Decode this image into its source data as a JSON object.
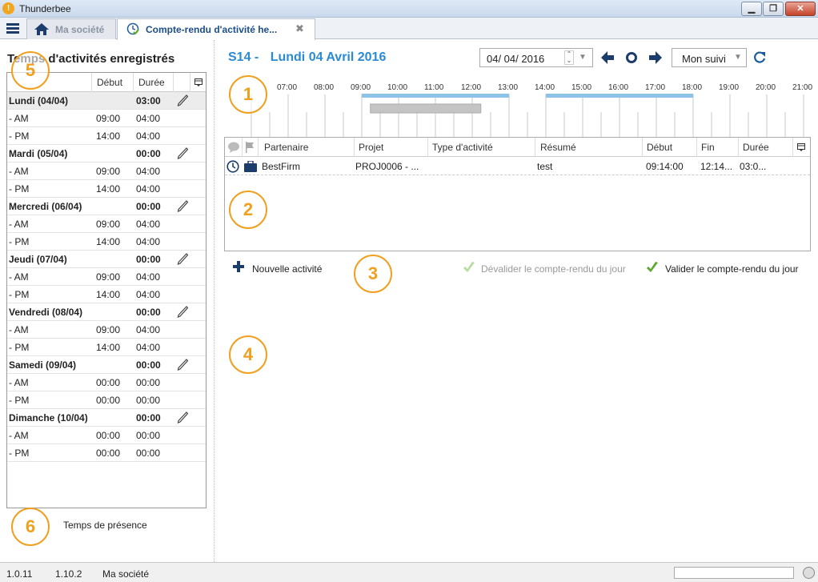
{
  "app": {
    "title": "Thunderbee"
  },
  "tabs": [
    {
      "label": "Ma société"
    },
    {
      "label": "Compte-rendu d'activité he..."
    }
  ],
  "left": {
    "title": "Temps d'activités enregistrés",
    "columns": [
      "",
      "Début",
      "Durée"
    ],
    "rows": [
      {
        "type": "day",
        "label": "Lundi (04/04)",
        "debut": "",
        "duree": "03:00"
      },
      {
        "type": "sub",
        "label": "- AM",
        "debut": "09:00",
        "duree": "04:00"
      },
      {
        "type": "sub",
        "label": "- PM",
        "debut": "14:00",
        "duree": "04:00"
      },
      {
        "type": "day",
        "label": "Mardi (05/04)",
        "debut": "",
        "duree": "00:00"
      },
      {
        "type": "sub",
        "label": "- AM",
        "debut": "09:00",
        "duree": "04:00"
      },
      {
        "type": "sub",
        "label": "- PM",
        "debut": "14:00",
        "duree": "04:00"
      },
      {
        "type": "day",
        "label": "Mercredi (06/04)",
        "debut": "",
        "duree": "00:00"
      },
      {
        "type": "sub",
        "label": "- AM",
        "debut": "09:00",
        "duree": "04:00"
      },
      {
        "type": "sub",
        "label": "- PM",
        "debut": "14:00",
        "duree": "04:00"
      },
      {
        "type": "day",
        "label": "Jeudi (07/04)",
        "debut": "",
        "duree": "00:00"
      },
      {
        "type": "sub",
        "label": "- AM",
        "debut": "09:00",
        "duree": "04:00"
      },
      {
        "type": "sub",
        "label": "- PM",
        "debut": "14:00",
        "duree": "04:00"
      },
      {
        "type": "day",
        "label": "Vendredi (08/04)",
        "debut": "",
        "duree": "00:00"
      },
      {
        "type": "sub",
        "label": "- AM",
        "debut": "09:00",
        "duree": "04:00"
      },
      {
        "type": "sub",
        "label": "- PM",
        "debut": "14:00",
        "duree": "04:00"
      },
      {
        "type": "day",
        "label": "Samedi (09/04)",
        "debut": "",
        "duree": "00:00"
      },
      {
        "type": "sub",
        "label": "- AM",
        "debut": "00:00",
        "duree": "00:00"
      },
      {
        "type": "sub",
        "label": "- PM",
        "debut": "00:00",
        "duree": "00:00"
      },
      {
        "type": "day",
        "label": "Dimanche (10/04)",
        "debut": "",
        "duree": "00:00"
      },
      {
        "type": "sub",
        "label": "- AM",
        "debut": "00:00",
        "duree": "00:00"
      },
      {
        "type": "sub",
        "label": "- PM",
        "debut": "00:00",
        "duree": "00:00"
      }
    ],
    "presence_label": "Temps de présence"
  },
  "header": {
    "week": "S14 -",
    "date_title": "Lundi 04 Avril 2016",
    "date_input": "04/ 04/  2016",
    "view_select": "Mon suivi"
  },
  "timeline": {
    "hours": [
      "07:00",
      "08:00",
      "09:00",
      "10:00",
      "11:00",
      "12:00",
      "13:00",
      "14:00",
      "15:00",
      "16:00",
      "17:00",
      "18:00",
      "19:00",
      "20:00",
      "21:00"
    ],
    "blue_ranges": [
      [
        "09:00",
        "13:00"
      ],
      [
        "14:00",
        "18:00"
      ]
    ],
    "activity_range": [
      "09:14",
      "12:14"
    ]
  },
  "grid": {
    "columns": [
      "Partenaire",
      "Projet",
      "Type d'activité",
      "Résumé",
      "Début",
      "Fin",
      "Durée"
    ],
    "rows": [
      {
        "partenaire": "BestFirm",
        "projet": "PROJ0006 - ...",
        "type": "",
        "resume": "test",
        "debut": "09:14:00",
        "fin": "12:14...",
        "duree": "03:0..."
      }
    ]
  },
  "actions": {
    "new_activity": "Nouvelle activité",
    "devalidate": "Dévalider le compte-rendu du jour",
    "validate": "Valider le compte-rendu du jour"
  },
  "badges": [
    "1",
    "2",
    "3",
    "4",
    "5",
    "6"
  ],
  "status": {
    "v1": "1.0.11",
    "v2": "1.10.2",
    "company": "Ma société"
  },
  "colors": {
    "accent_blue": "#2a8bd4",
    "badge_orange": "#f0a020",
    "nav_dark": "#1c3d6b",
    "check_green": "#5ba82b"
  }
}
